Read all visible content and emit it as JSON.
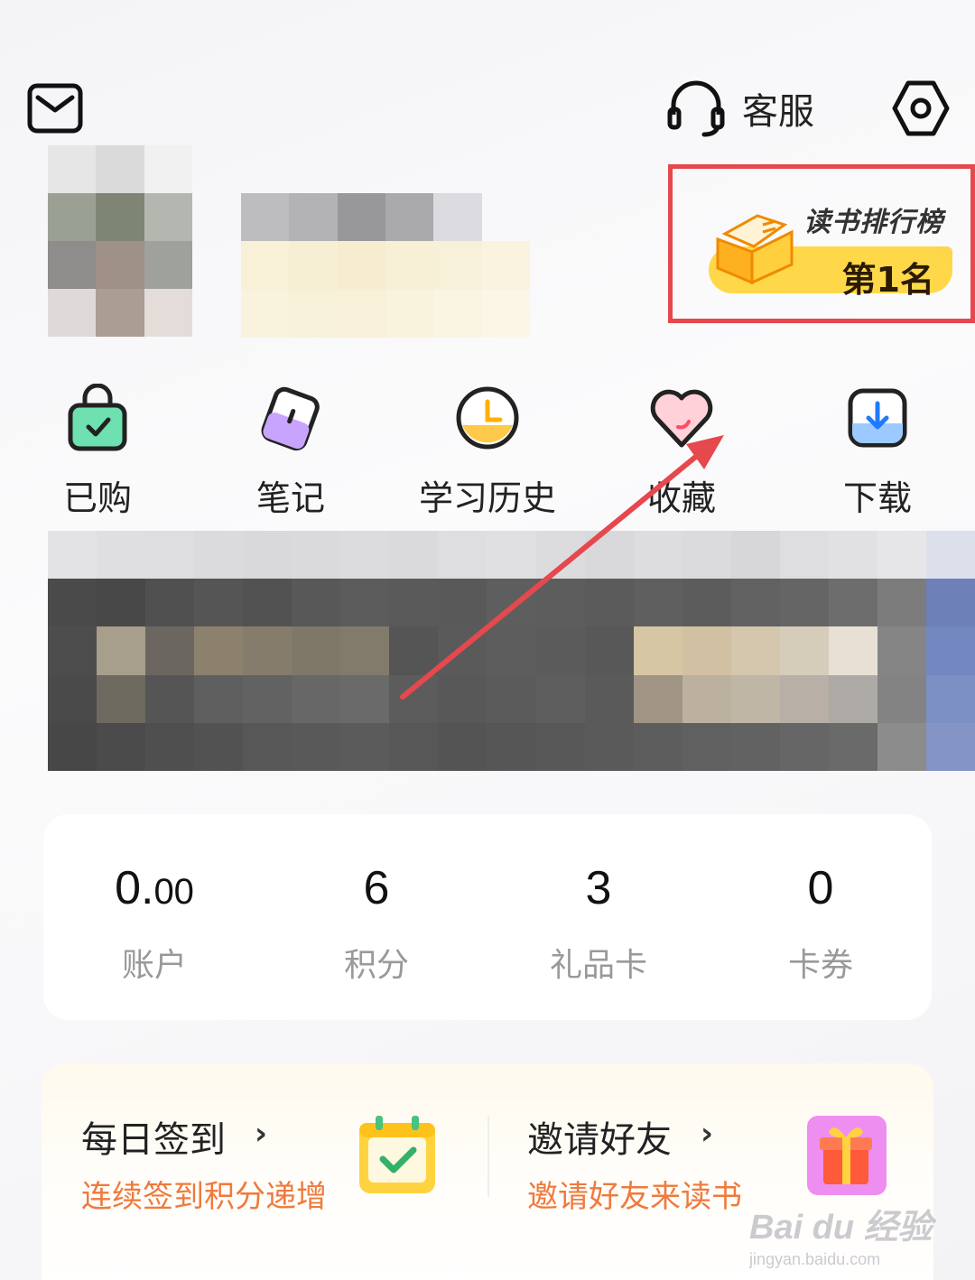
{
  "header": {
    "mail_icon": "mail-icon",
    "customer_service_label": "客服",
    "customer_service_icon": "headset-icon",
    "settings_icon": "hex-settings-icon"
  },
  "rank_badge": {
    "title": "读书排行榜",
    "value": "第1名",
    "highlight_color": "#e5484d"
  },
  "quick_actions": [
    {
      "label": "已购",
      "icon": "shopping-bag-icon"
    },
    {
      "label": "笔记",
      "icon": "note-icon"
    },
    {
      "label": "学习历史",
      "icon": "clock-icon"
    },
    {
      "label": "收藏",
      "icon": "heart-icon"
    },
    {
      "label": "下载",
      "icon": "download-icon"
    }
  ],
  "stats": [
    {
      "value_main": "0.",
      "value_decimal": "00",
      "label": "账户"
    },
    {
      "value_main": "6",
      "value_decimal": "",
      "label": "积分"
    },
    {
      "value_main": "3",
      "value_decimal": "",
      "label": "礼品卡"
    },
    {
      "value_main": "0",
      "value_decimal": "",
      "label": "卡券"
    }
  ],
  "promos": [
    {
      "title": "每日签到",
      "chevron": "›",
      "subtitle": "连续签到积分递增",
      "icon": "calendar-check-icon"
    },
    {
      "title": "邀请好友",
      "chevron": "›",
      "subtitle": "邀请好友来读书",
      "icon": "gift-icon"
    }
  ],
  "watermark": {
    "logo": "Bai du 经验",
    "url": "jingyan.baidu.com"
  },
  "colors": {
    "accent_orange": "#ef7a3d",
    "annotation_red": "#e5484d"
  }
}
